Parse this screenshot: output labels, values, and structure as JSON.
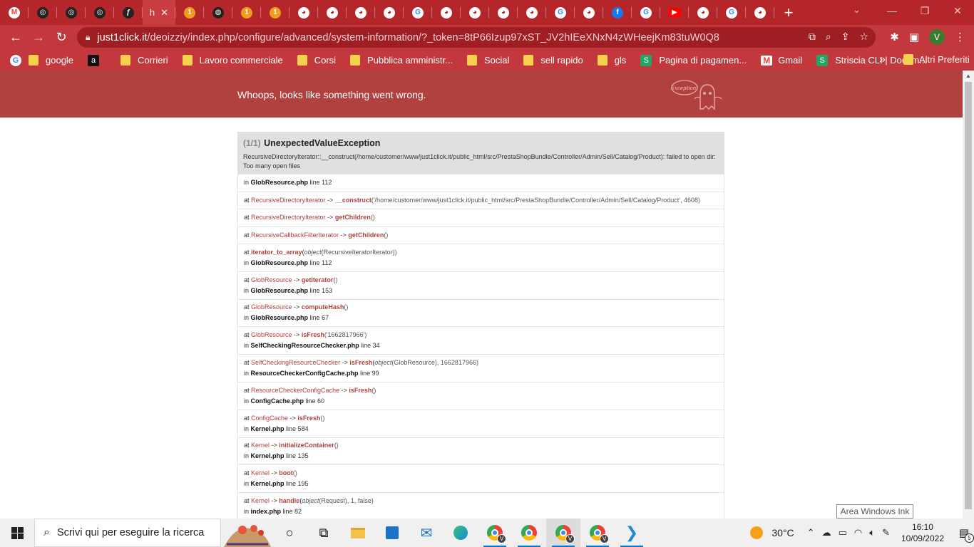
{
  "browser": {
    "active_tab_title": "h",
    "tab_close": "✕",
    "new_tab": "+",
    "url_domain": "just1click.it",
    "url_path": "/deoizziy/index.php/configure/advanced/system-information/?_token=8tP66Izup97xST_JV2hIEeXNxN4zWHeejKm83tuW0Q8",
    "profile_initial": "V",
    "bookmarks": [
      {
        "label": "google",
        "icon": "google"
      },
      {
        "label": "",
        "icon": "amazon"
      },
      {
        "label": "Corrieri",
        "icon": "folder"
      },
      {
        "label": "Lavoro commerciale",
        "icon": "folder"
      },
      {
        "label": "Corsi",
        "icon": "folder"
      },
      {
        "label": "Pubblica amministr...",
        "icon": "folder"
      },
      {
        "label": "Social",
        "icon": "folder"
      },
      {
        "label": "sell rapido",
        "icon": "folder"
      },
      {
        "label": "gls",
        "icon": "folder"
      },
      {
        "label": "Pagina di pagamen...",
        "icon": "sheets"
      },
      {
        "label": "Gmail",
        "icon": "gmail"
      },
      {
        "label": "Striscia CLI | Docum...",
        "icon": "sheets"
      }
    ],
    "bookmarks_more": "»",
    "other_bookmarks": "Altri Preferiti"
  },
  "page": {
    "header_message": "Whoops, looks like something went wrong.",
    "ghost_label": "Exception!",
    "exception": {
      "count": "(1/1)",
      "class": "UnexpectedValueException",
      "message": "RecursiveDirectoryIterator::__construct(/home/customer/www/just1click.it/public_html/src/PrestaShopBundle/Controller/Admin/Sell/Catalog/Product): failed to open dir: Too many open files"
    },
    "frames": [
      {
        "type": "in",
        "file": "GlobResource.php",
        "line": "line 112"
      },
      {
        "type": "at",
        "cls": "RecursiveDirectoryIterator",
        "fn": "__construct",
        "args": "('/home/customer/www/just1click.it/public_html/src/PrestaShopBundle/Controller/Admin/Sell/Catalog/Product', 4608)"
      },
      {
        "type": "at",
        "cls": "RecursiveDirectoryIterator",
        "fn": "getChildren",
        "args": "()"
      },
      {
        "type": "at",
        "cls": "RecursiveCallbackFilterIterator",
        "fn": "getChildren",
        "args": "()"
      },
      {
        "type": "at2",
        "cls": "",
        "fn": "iterator_to_array",
        "args_italic": "object",
        "args": "(RecursiveIteratorIterator))",
        "file": "GlobResource.php",
        "line": "line 112"
      },
      {
        "type": "at2",
        "cls": "GlobResource",
        "fn": "getIterator",
        "args": "()",
        "file": "GlobResource.php",
        "line": "line 153"
      },
      {
        "type": "at2",
        "cls": "GlobResource",
        "fn": "computeHash",
        "args": "()",
        "file": "GlobResource.php",
        "line": "line 67"
      },
      {
        "type": "at2",
        "cls": "GlobResource",
        "fn": "isFresh",
        "args": "('1662817966')",
        "file": "SelfCheckingResourceChecker.php",
        "line": "line 34"
      },
      {
        "type": "at2",
        "cls": "SelfCheckingResourceChecker",
        "fn": "isFresh",
        "args_italic": "object",
        "args": "(GlobResource), 1662817966)",
        "file": "ResourceCheckerConfigCache.php",
        "line": "line 99"
      },
      {
        "type": "at2",
        "cls": "ResourceCheckerConfigCache",
        "fn": "isFresh",
        "args": "()",
        "file": "ConfigCache.php",
        "line": "line 60"
      },
      {
        "type": "at2",
        "cls": "ConfigCache",
        "fn": "isFresh",
        "args": "()",
        "file": "Kernel.php",
        "line": "line 584"
      },
      {
        "type": "at2",
        "cls": "Kernel",
        "fn": "initializeContainer",
        "args": "()",
        "file": "Kernel.php",
        "line": "line 135"
      },
      {
        "type": "at2",
        "cls": "Kernel",
        "fn": "boot",
        "args": "()",
        "file": "Kernel.php",
        "line": "line 195"
      },
      {
        "type": "at2",
        "cls": "Kernel",
        "fn": "handle",
        "args_italic": "object",
        "args": "(Request), 1, false)",
        "file": "index.php",
        "line": "line 82"
      }
    ],
    "tooltip": "Area Windows Ink"
  },
  "taskbar": {
    "search_placeholder": "Scrivi qui per eseguire la ricerca",
    "temperature": "30°C",
    "time": "16:10",
    "date": "10/09/2022",
    "notifications": "5"
  }
}
